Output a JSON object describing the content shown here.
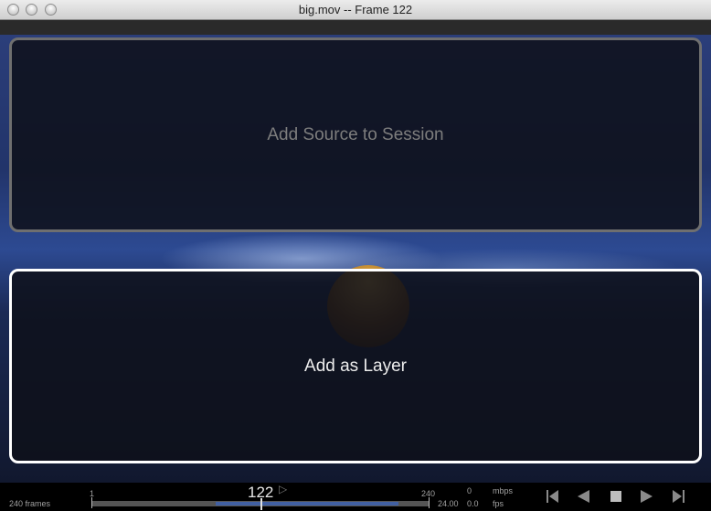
{
  "window": {
    "title": "big.mov -- Frame 122"
  },
  "overlay": {
    "top_panel_label": "Add Source to Session",
    "bottom_panel_label": "Add as Layer"
  },
  "status": {
    "frames_label": "240 frames",
    "current_frame": "122",
    "range_start": "1",
    "range_end": "240",
    "fps_value": "24.00",
    "data_rate": "0",
    "data_rate_unit": "mbps",
    "actual_fps": "0.0",
    "fps_unit": "fps"
  },
  "controls": {
    "step_back_icon": "step-back-icon",
    "play_reverse_icon": "play-reverse-icon",
    "stop_icon": "stop-icon",
    "play_icon": "play-icon",
    "step_forward_icon": "step-forward-icon"
  }
}
